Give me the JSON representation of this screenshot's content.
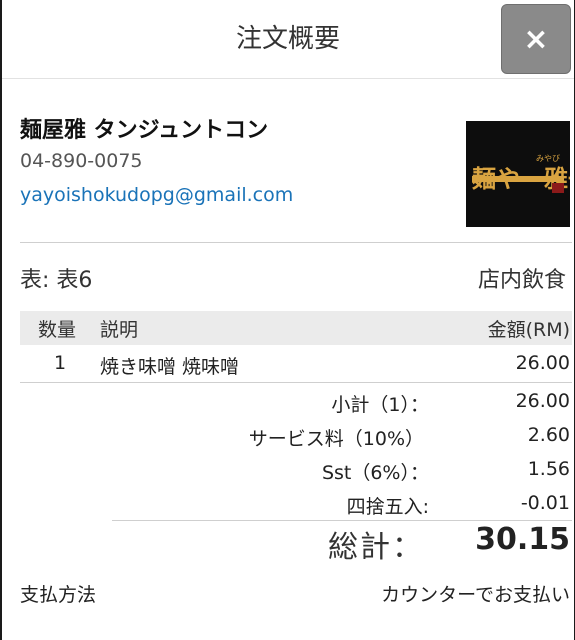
{
  "header": {
    "title": "注文概要",
    "close_label": "×"
  },
  "store": {
    "name": "麺屋雅 タンジュントコン",
    "phone": "04-890-0075",
    "email": "yayoishokudopg@gmail.com",
    "logo_text": "麺や一雅一",
    "logo_small": "みやび"
  },
  "order": {
    "table": "表: 表6",
    "type": "店内飲食"
  },
  "columns": {
    "qty": "数量",
    "desc": "説明",
    "amount": "金額(RM)"
  },
  "items": [
    {
      "qty": "1",
      "desc": "焼き味噌 焼味噌",
      "amount": "26.00"
    }
  ],
  "summary": [
    {
      "label": "小計（1）：",
      "value": "26.00"
    },
    {
      "label": "サービス料（10%）",
      "value": "2.60"
    },
    {
      "label": "Sst（6%）：",
      "value": "1.56"
    },
    {
      "label": "四捨五入:",
      "value": "-0.01"
    }
  ],
  "total": {
    "label": "総計：",
    "value": "30.15"
  },
  "payment": {
    "label": "支払方法",
    "value": "カウンターでお支払い"
  },
  "colors": {
    "email": "#1a73b8",
    "close_bg": "#8a8a8a",
    "logo_gold": "#d9a441"
  }
}
